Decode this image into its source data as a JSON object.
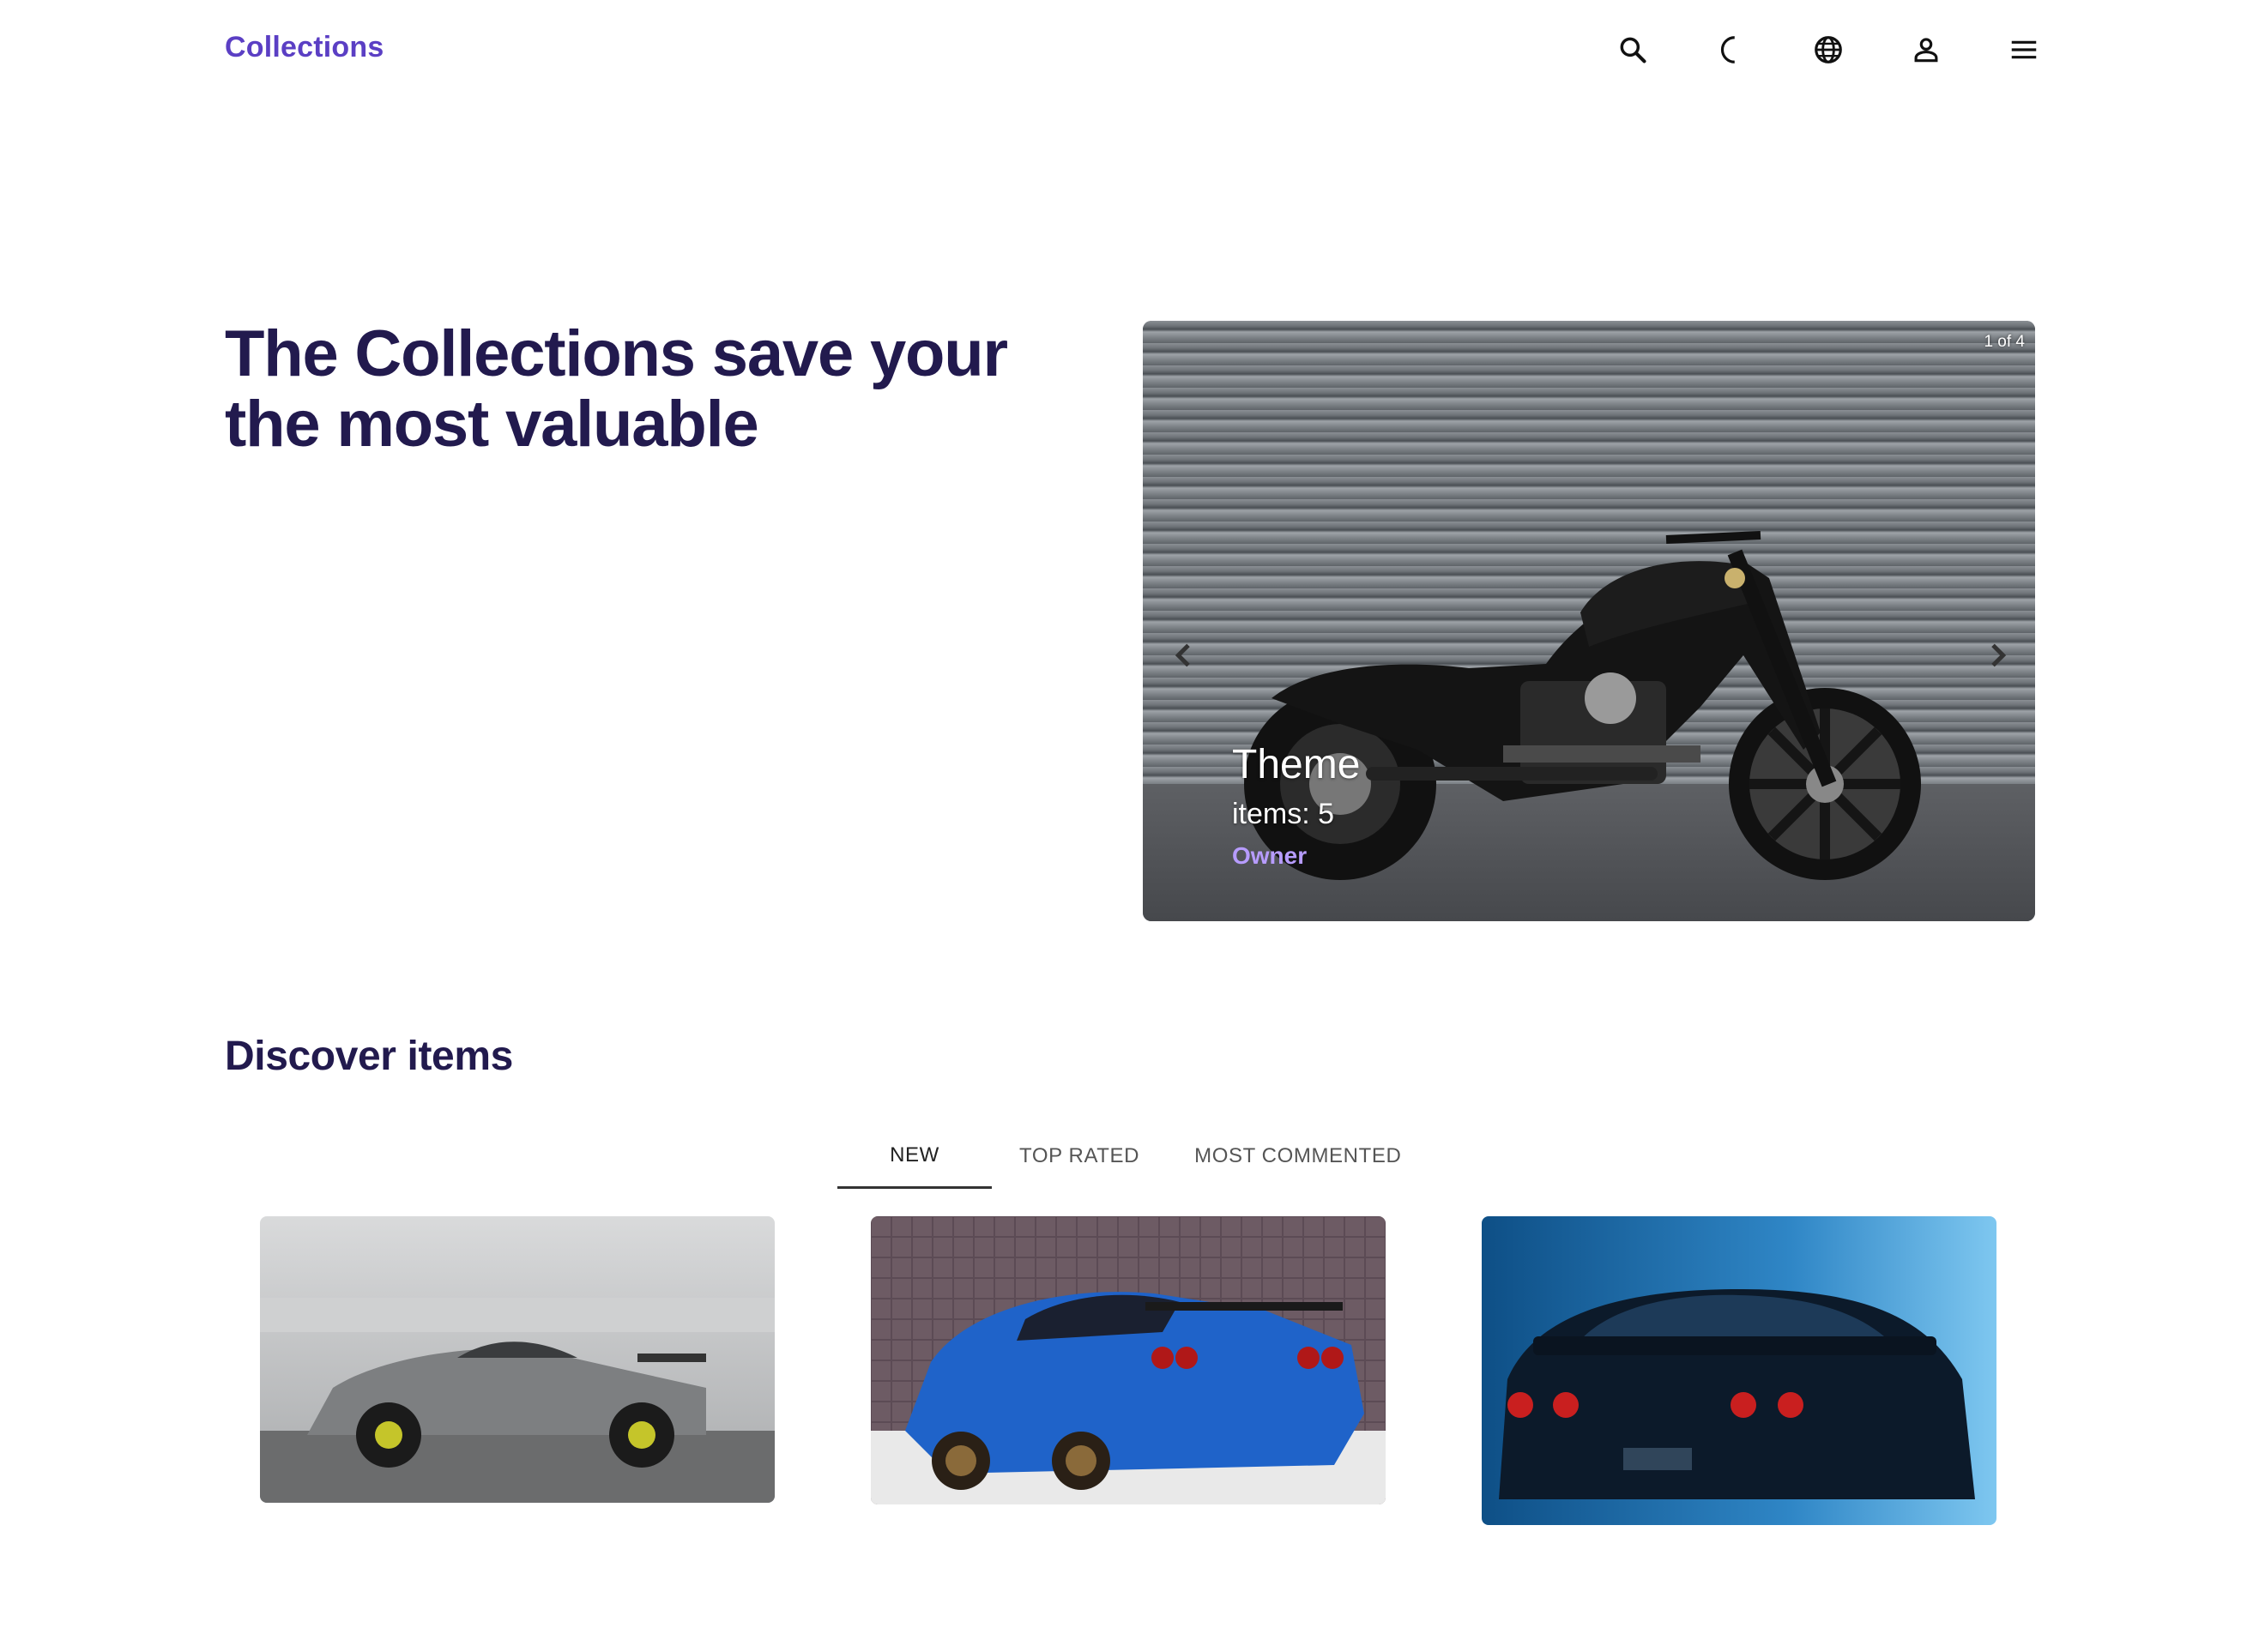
{
  "header": {
    "brand": "Collections",
    "icons": [
      "search-icon",
      "moon-icon",
      "globe-icon",
      "user-icon",
      "menu-icon"
    ]
  },
  "hero": {
    "title": "The Collections save your the most valuable"
  },
  "carousel": {
    "counter": "1 of 4",
    "slide_title": "Theme",
    "slide_items": "items: 5",
    "slide_owner": "Owner",
    "colors": {
      "owner": "#b79cff"
    }
  },
  "discover": {
    "title": "Discover items",
    "tabs": [
      {
        "label": "NEW",
        "active": true
      },
      {
        "label": "TOP RATED",
        "active": false
      },
      {
        "label": "MOST COMMENTED",
        "active": false
      }
    ]
  },
  "colors": {
    "brand": "#5b3fc4",
    "heading": "#221a4e"
  }
}
